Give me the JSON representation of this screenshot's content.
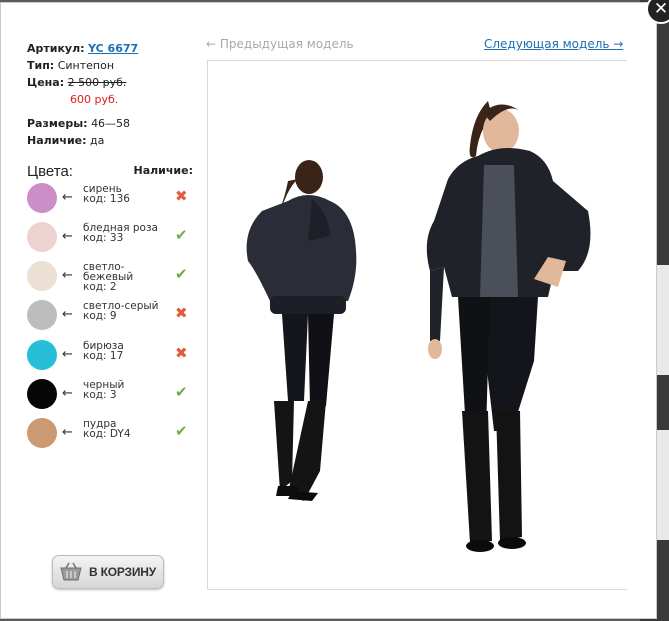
{
  "product": {
    "article_label": "Артикул:",
    "article_value": "YC 6677",
    "type_label": "Тип:",
    "type_value": "Синтепон",
    "price_label": "Цена:",
    "old_price": "2 500 руб.",
    "new_price": "600 руб.",
    "sizes_label": "Размеры:",
    "sizes_value": "46—58",
    "stock_label": "Наличие:",
    "stock_value": "да"
  },
  "colors": {
    "title": "Цвета:",
    "availability_header": "Наличие:",
    "items": [
      {
        "line1": "сирень",
        "line2": "код: 136",
        "swatch": "#cc8ec9",
        "available": false
      },
      {
        "line1": "бледная роза",
        "line2": "код: 33",
        "swatch": "#ecd3d2",
        "available": true
      },
      {
        "line1": "светло-",
        "line2": "бежевый",
        "line3": "код: 2",
        "swatch": "#ecdfd3",
        "available": true
      },
      {
        "line1": "светло-серый",
        "line2": "код: 9",
        "swatch": "#bdbdbd",
        "available": false
      },
      {
        "line1": "бирюза",
        "line2": "код: 17",
        "swatch": "#26bfd5",
        "available": false
      },
      {
        "line1": "черный",
        "line2": "код: 3",
        "swatch": "#050505",
        "available": true
      },
      {
        "line1": "пудра",
        "line2": "код: DY4",
        "swatch": "#cc9a72",
        "available": true
      }
    ]
  },
  "cart_button": {
    "label": "В КОРЗИНУ",
    "icon": "basket-icon"
  },
  "navigation": {
    "prev": "← Предыдущая модель",
    "next": "Следующая модель →"
  },
  "close": {
    "label": "✕",
    "icon": "close-icon"
  },
  "status_icons": {
    "yes": "✔",
    "no": "✖"
  }
}
